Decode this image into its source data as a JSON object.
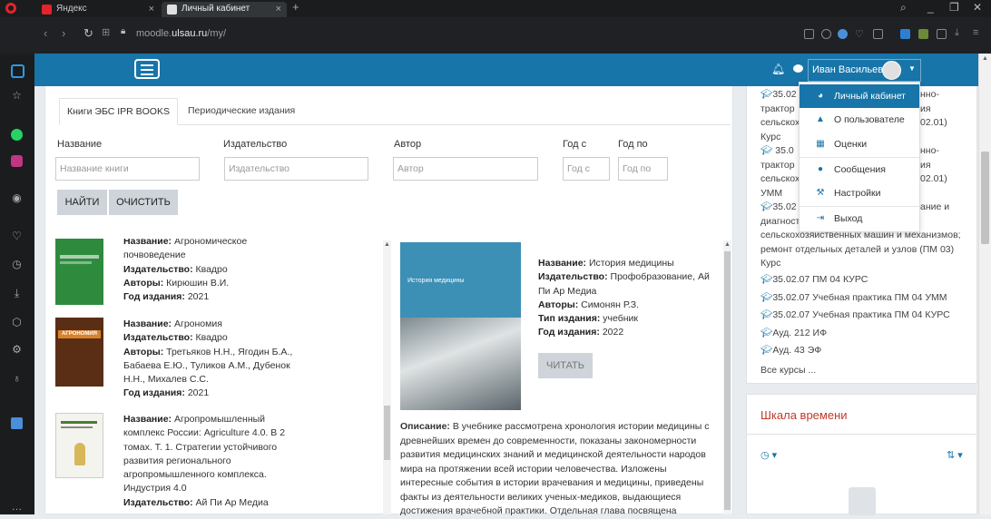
{
  "browser": {
    "tabs": [
      {
        "label": "Яндекс",
        "active": false
      },
      {
        "label": "Личный кабинет",
        "active": true
      }
    ],
    "new_tab": "+",
    "url_prefix": "moodle.",
    "url_domain": "ulsau.ru",
    "url_path": "/my/"
  },
  "navbar": {
    "user_name": "Иван Васильев"
  },
  "user_menu": {
    "items": [
      {
        "label": "Личный кабинет",
        "icon": "dashboard-icon",
        "active": true
      },
      {
        "label": "О пользователе",
        "icon": "user-icon",
        "active": false
      },
      {
        "label": "Оценки",
        "icon": "table-icon",
        "active": false
      },
      {
        "label": "Сообщения",
        "icon": "chat-icon",
        "active": false
      },
      {
        "label": "Настройки",
        "icon": "wrench-icon",
        "active": false
      },
      {
        "label": "Выход",
        "icon": "logout-icon",
        "active": false
      }
    ]
  },
  "library": {
    "tabs": [
      "Книги ЭБС IPR BOOKS",
      "Периодические издания"
    ],
    "fields": {
      "title_label": "Название",
      "title_placeholder": "Название книги",
      "publisher_label": "Издательство",
      "publisher_placeholder": "Издательство",
      "author_label": "Автор",
      "author_placeholder": "Автор",
      "year_from_label": "Год с",
      "year_from_placeholder": "Год с",
      "year_to_label": "Год по",
      "year_to_placeholder": "Год по"
    },
    "find_button": "НАЙТИ",
    "clear_button": "ОЧИСТИТЬ",
    "keys": {
      "title": "Название:",
      "publisher": "Издательство:",
      "authors": "Авторы:",
      "year": "Год издания:",
      "type": "Тип издания:",
      "description": "Описание:"
    },
    "books": [
      {
        "title": "Агрономическое почвоведение",
        "publisher": "Квадро",
        "authors": "Кирюшин В.И.",
        "year": "2021"
      },
      {
        "title": "Агрономия",
        "publisher": "Квадро",
        "authors": "Третьяков Н.Н., Ягодин Б.А., Бабаева Е.Ю., Туликов А.М., Дубенок Н.Н., Михалев С.С.",
        "year": "2021",
        "cover_title": "АГРОНОМИЯ"
      },
      {
        "title": "Агропромышленный комплекс России: Agriculture 4.0. В 2 томах. Т. 1. Стратегии устойчивого развития регионального агропромышленного комплекса. Индустрия 4.0",
        "publisher": "Ай Пи Ар Медиа"
      }
    ],
    "detail": {
      "title": "История медицины",
      "publisher": "Профобразование, Ай Пи Ар Медиа",
      "authors": "Симонян Р.З.",
      "type": "учебник",
      "year": "2022",
      "read_button": "ЧИТАТЬ",
      "cover_title": "История медицины",
      "description": "В учебнике рассмотрена хронология истории медицины с древнейших времен до современности, показаны закономерности развития медицинских знаний и медицинской деятельности народов мира на протяжении всей истории человечества. Изложены интересные события в истории врачевания и медицины, приведены факты из деятельности великих ученых-медиков, выдающиеся достижения врачебной практики. Отдельная глава посвящена"
    }
  },
  "courses": {
    "fragments": [
      {
        "prefix": "35.02",
        "rest": "нно-"
      },
      {
        "text": "трактор",
        "rest": "ия"
      },
      {
        "text": "сельскох",
        "rest": "02.01)"
      },
      {
        "text": "Курс"
      },
      {
        "prefix": "35.0",
        "rest": "нно-"
      },
      {
        "text": "трактор",
        "rest": "ия"
      },
      {
        "text": "сельскох",
        "rest": "02.01)"
      },
      {
        "text": "УММ"
      },
      {
        "prefix": "35.02",
        "rest": "ание и"
      },
      {
        "text": "диагност"
      }
    ],
    "lines": [
      "сельскохозяйственных машин и механизмов;",
      "ремонт отдельных деталей и узлов (ПМ 03)",
      "Курс"
    ],
    "items": [
      "35.02.07 ПМ 04 КУРС",
      "35.02.07 Учебная практика ПМ 04 УММ",
      "35.02.07 Учебная практика ПМ 04 КУРС",
      "Ауд. 212 ИФ",
      "Ауд. 43 ЭФ"
    ],
    "all_courses": "Все курсы ..."
  },
  "timeline": {
    "title": "Шкала времени"
  },
  "colors": {
    "brand": "#1775a9",
    "timeline_title": "#c0392b"
  }
}
